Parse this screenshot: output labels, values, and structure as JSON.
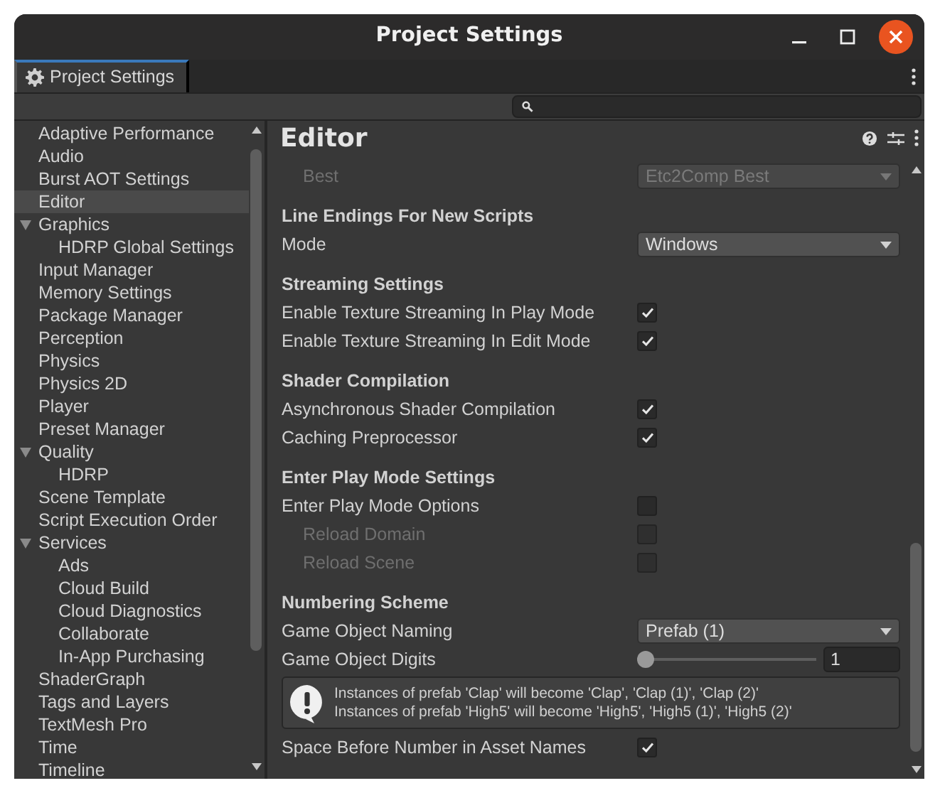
{
  "window": {
    "title": "Project Settings"
  },
  "tab": {
    "label": "Project Settings",
    "selected": true
  },
  "sidebar": {
    "items": [
      {
        "label": "Adaptive Performance",
        "selected": false
      },
      {
        "label": "Audio",
        "selected": false
      },
      {
        "label": "Burst AOT Settings",
        "selected": false
      },
      {
        "label": "Editor",
        "selected": true
      },
      {
        "label": "Graphics",
        "selected": false,
        "expanded": true,
        "children": [
          {
            "label": "HDRP Global Settings",
            "selected": false
          }
        ]
      },
      {
        "label": "Input Manager",
        "selected": false
      },
      {
        "label": "Memory Settings",
        "selected": false
      },
      {
        "label": "Package Manager",
        "selected": false
      },
      {
        "label": "Perception",
        "selected": false
      },
      {
        "label": "Physics",
        "selected": false
      },
      {
        "label": "Physics 2D",
        "selected": false
      },
      {
        "label": "Player",
        "selected": false
      },
      {
        "label": "Preset Manager",
        "selected": false
      },
      {
        "label": "Quality",
        "selected": false,
        "expanded": true,
        "children": [
          {
            "label": "HDRP",
            "selected": false
          }
        ]
      },
      {
        "label": "Scene Template",
        "selected": false
      },
      {
        "label": "Script Execution Order",
        "selected": false
      },
      {
        "label": "Services",
        "selected": false,
        "expanded": true,
        "children": [
          {
            "label": "Ads",
            "selected": false
          },
          {
            "label": "Cloud Build",
            "selected": false
          },
          {
            "label": "Cloud Diagnostics",
            "selected": false
          },
          {
            "label": "Collaborate",
            "selected": false
          },
          {
            "label": "In-App Purchasing",
            "selected": false
          }
        ]
      },
      {
        "label": "ShaderGraph",
        "selected": false
      },
      {
        "label": "Tags and Layers",
        "selected": false
      },
      {
        "label": "TextMesh Pro",
        "selected": false
      },
      {
        "label": "Time",
        "selected": false
      },
      {
        "label": "Timeline",
        "selected": false
      }
    ]
  },
  "panel": {
    "title": "Editor",
    "sections": [
      {
        "rows": [
          {
            "kind": "dropdown",
            "label": "Best",
            "value": "Etc2Comp Best",
            "disabled": true
          }
        ]
      },
      {
        "heading": "Line Endings For New Scripts",
        "rows": [
          {
            "kind": "dropdown",
            "label": "Mode",
            "value": "Windows",
            "disabled": false
          }
        ]
      },
      {
        "heading": "Streaming Settings",
        "rows": [
          {
            "kind": "checkbox",
            "label": "Enable Texture Streaming In Play Mode",
            "checked": true,
            "disabled": false
          },
          {
            "kind": "checkbox",
            "label": "Enable Texture Streaming In Edit Mode",
            "checked": true,
            "disabled": false
          }
        ]
      },
      {
        "heading": "Shader Compilation",
        "rows": [
          {
            "kind": "checkbox",
            "label": "Asynchronous Shader Compilation",
            "checked": true,
            "disabled": false
          },
          {
            "kind": "checkbox",
            "label": "Caching Preprocessor",
            "checked": true,
            "disabled": false
          }
        ]
      },
      {
        "heading": "Enter Play Mode Settings",
        "rows": [
          {
            "kind": "checkbox",
            "label": "Enter Play Mode Options",
            "checked": false,
            "disabled": false,
            "children": [
              {
                "kind": "checkbox",
                "label": "Reload Domain",
                "checked": false,
                "disabled": true
              },
              {
                "kind": "checkbox",
                "label": "Reload Scene",
                "checked": false,
                "disabled": true
              }
            ]
          }
        ]
      },
      {
        "heading": "Numbering Scheme",
        "rows": [
          {
            "kind": "dropdown",
            "label": "Game Object Naming",
            "value": "Prefab (1)",
            "disabled": false
          },
          {
            "kind": "slider",
            "label": "Game Object Digits",
            "value": "1",
            "level": 0.0
          },
          {
            "kind": "help",
            "lines": [
              "Instances of prefab 'Clap' will become 'Clap', 'Clap (1)', 'Clap (2)'",
              "Instances of prefab 'High5' will become 'High5', 'High5 (1)', 'High5 (2)'"
            ]
          },
          {
            "kind": "checkbox",
            "label": "Space Before Number in Asset Names",
            "checked": true,
            "disabled": false
          }
        ]
      }
    ]
  }
}
